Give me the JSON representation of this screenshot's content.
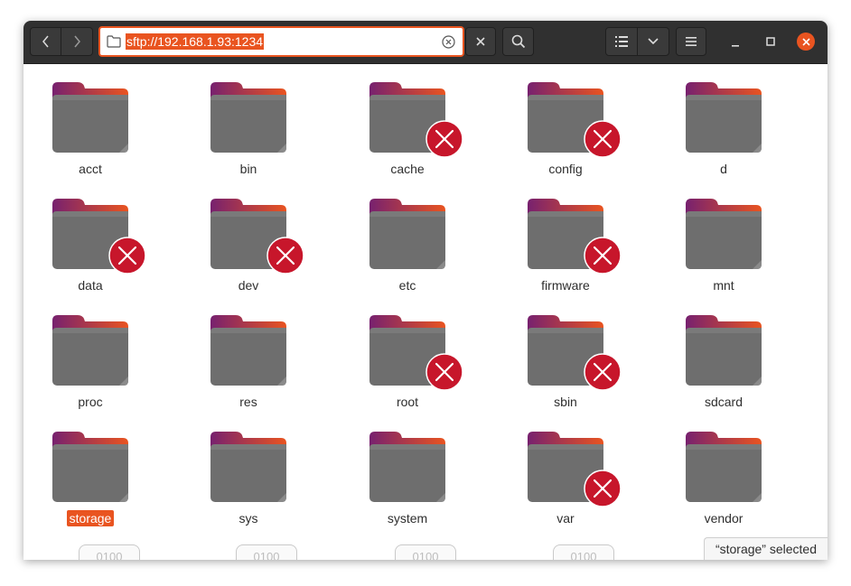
{
  "location": {
    "url": "sftp://192.168.1.93:1234"
  },
  "files": [
    {
      "name": "acct",
      "locked": false
    },
    {
      "name": "bin",
      "locked": false
    },
    {
      "name": "cache",
      "locked": true
    },
    {
      "name": "config",
      "locked": true
    },
    {
      "name": "d",
      "locked": false
    },
    {
      "name": "data",
      "locked": true
    },
    {
      "name": "dev",
      "locked": true
    },
    {
      "name": "etc",
      "locked": false
    },
    {
      "name": "firmware",
      "locked": true
    },
    {
      "name": "mnt",
      "locked": false
    },
    {
      "name": "proc",
      "locked": false
    },
    {
      "name": "res",
      "locked": false
    },
    {
      "name": "root",
      "locked": true
    },
    {
      "name": "sbin",
      "locked": true
    },
    {
      "name": "sdcard",
      "locked": false
    },
    {
      "name": "storage",
      "locked": false,
      "selected": true
    },
    {
      "name": "sys",
      "locked": false
    },
    {
      "name": "system",
      "locked": false
    },
    {
      "name": "var",
      "locked": true
    },
    {
      "name": "vendor",
      "locked": false
    }
  ],
  "partial_files": [
    {
      "name": "0100"
    },
    {
      "name": "0100"
    },
    {
      "name": "0100"
    },
    {
      "name": "0100"
    }
  ],
  "status": {
    "text": "“storage” selected"
  },
  "colors": {
    "accent": "#e95420",
    "error_badge": "#c7162b",
    "folder_body": "#6e6e6e",
    "folder_tab_start": "#77216f",
    "folder_tab_end": "#e95420",
    "headerbar": "#303030"
  },
  "icons": {
    "back": "chevron-left-icon",
    "forward": "chevron-right-icon",
    "location_folder": "folder-icon",
    "clear_location": "clear-circle-icon",
    "close_location": "close-icon",
    "search": "search-icon",
    "list_view": "list-view-icon",
    "view_options": "chevron-down-icon",
    "menu": "hamburger-menu-icon",
    "minimize": "minimize-icon",
    "maximize": "maximize-icon",
    "close_window": "window-close-icon",
    "unreadable": "unreadable-x-badge-icon"
  }
}
